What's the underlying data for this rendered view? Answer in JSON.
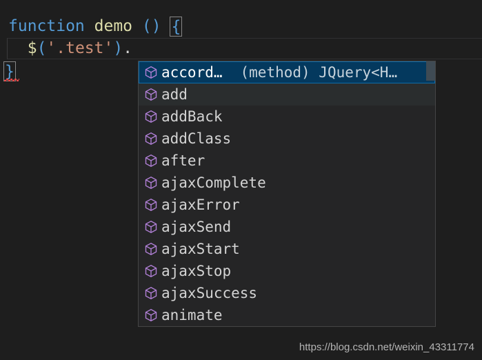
{
  "editor": {
    "background_color": "#1e1e1e",
    "lines": [
      {
        "id": "line1",
        "tokens": [
          {
            "text": "function",
            "kind": "keyword"
          },
          {
            "text": " ",
            "kind": "plain"
          },
          {
            "text": "demo",
            "kind": "func"
          },
          {
            "text": " ",
            "kind": "plain"
          },
          {
            "text": "(",
            "kind": "paren"
          },
          {
            "text": ")",
            "kind": "paren"
          },
          {
            "text": " ",
            "kind": "plain"
          },
          {
            "text": "{",
            "kind": "brace-match"
          }
        ],
        "plain_text": "function demo () {"
      },
      {
        "id": "line2",
        "plain_text": "  $('.test')."
      },
      {
        "id": "line3",
        "plain_text": "}"
      }
    ],
    "line1": {
      "keyword": "function",
      "space1": " ",
      "name": "demo",
      "space2": " ",
      "open_paren": "(",
      "close_paren": ")",
      "space3": " ",
      "open_brace": "{"
    },
    "line2": {
      "dollar": "$",
      "open_paren": "(",
      "string": "'.test'",
      "close_paren": ")",
      "dot": "."
    },
    "line3": {
      "close_brace": "}"
    }
  },
  "suggest": {
    "selected_index": 0,
    "focused_index": 1,
    "selected_background": "#04395e",
    "popup_background": "#252526",
    "popup_border": "#454545",
    "icon_color": "#b180d7",
    "icon_name": "symbol-method-cube-icon",
    "items": [
      {
        "label": "accord…",
        "detail": "(method) JQuery<H…",
        "icon": "symbol-method-cube-icon"
      },
      {
        "label": "add",
        "detail": "",
        "icon": "symbol-method-cube-icon"
      },
      {
        "label": "addBack",
        "detail": "",
        "icon": "symbol-method-cube-icon"
      },
      {
        "label": "addClass",
        "detail": "",
        "icon": "symbol-method-cube-icon"
      },
      {
        "label": "after",
        "detail": "",
        "icon": "symbol-method-cube-icon"
      },
      {
        "label": "ajaxComplete",
        "detail": "",
        "icon": "symbol-method-cube-icon"
      },
      {
        "label": "ajaxError",
        "detail": "",
        "icon": "symbol-method-cube-icon"
      },
      {
        "label": "ajaxSend",
        "detail": "",
        "icon": "symbol-method-cube-icon"
      },
      {
        "label": "ajaxStart",
        "detail": "",
        "icon": "symbol-method-cube-icon"
      },
      {
        "label": "ajaxStop",
        "detail": "",
        "icon": "symbol-method-cube-icon"
      },
      {
        "label": "ajaxSuccess",
        "detail": "",
        "icon": "symbol-method-cube-icon"
      },
      {
        "label": "animate",
        "detail": "",
        "icon": "symbol-method-cube-icon"
      }
    ]
  },
  "watermark": {
    "text": "https://blog.csdn.net/weixin_43311774"
  }
}
